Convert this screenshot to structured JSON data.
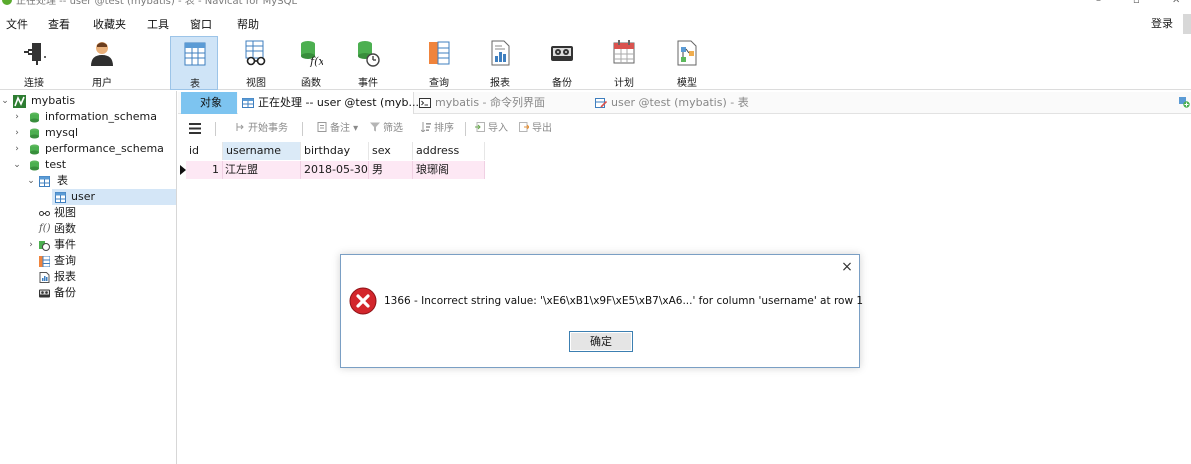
{
  "window": {
    "title": "正在处理 -- user @test (mybatis) - 表 - Navicat for MySQL",
    "controls": [
      "–",
      "▫",
      "✕"
    ]
  },
  "menu": {
    "items": [
      "文件",
      "查看",
      "收藏夹",
      "工具",
      "窗口",
      "帮助"
    ],
    "login": "登录"
  },
  "toolbar": {
    "items": [
      {
        "label": "连接",
        "icon": "plug-icon"
      },
      {
        "label": "用户",
        "icon": "user-icon"
      },
      {
        "label": "表",
        "icon": "table-icon"
      },
      {
        "label": "视图",
        "icon": "view-icon"
      },
      {
        "label": "函数",
        "icon": "function-icon"
      },
      {
        "label": "事件",
        "icon": "event-icon"
      },
      {
        "label": "查询",
        "icon": "query-icon"
      },
      {
        "label": "报表",
        "icon": "report-icon"
      },
      {
        "label": "备份",
        "icon": "backup-icon"
      },
      {
        "label": "计划",
        "icon": "schedule-icon"
      },
      {
        "label": "模型",
        "icon": "model-icon"
      }
    ],
    "active_index": 2
  },
  "sidebar": {
    "connection": "mybatis",
    "databases": [
      "information_schema",
      "mysql",
      "performance_schema",
      "test"
    ],
    "test_children": {
      "tables_label": "表",
      "table_user": "user",
      "views": "视图",
      "functions": "函数",
      "events": "事件",
      "queries": "查询",
      "reports": "报表",
      "backups": "备份"
    }
  },
  "tabs": [
    {
      "label": "对象"
    },
    {
      "label": "正在处理 -- user @test (myb..."
    },
    {
      "label": "mybatis - 命令列界面"
    },
    {
      "label": "user @test (mybatis) - 表"
    }
  ],
  "object_toolbar": {
    "begin_transaction": "开始事务",
    "note": "备注",
    "filter": "筛选",
    "sort": "排序",
    "import": "导入",
    "export": "导出"
  },
  "grid": {
    "columns": [
      "id",
      "username",
      "birthday",
      "sex",
      "address"
    ],
    "rows": [
      {
        "id": "1",
        "username": "江左盟",
        "birthday": "2018-05-30",
        "sex": "男",
        "address": "琅琊阁"
      }
    ]
  },
  "dialog": {
    "close": "×",
    "message": "1366 - Incorrect string value: '\\xE6\\xB1\\x9F\\xE5\\xB7\\xA6...' for column 'username' at row 1",
    "ok_label": "确定"
  },
  "colors": {
    "accent_tab": "#7dc4f0",
    "row_highlight": "#fde8f4",
    "selected_tree": "#d4e6f7",
    "error_red": "#d3262c"
  }
}
